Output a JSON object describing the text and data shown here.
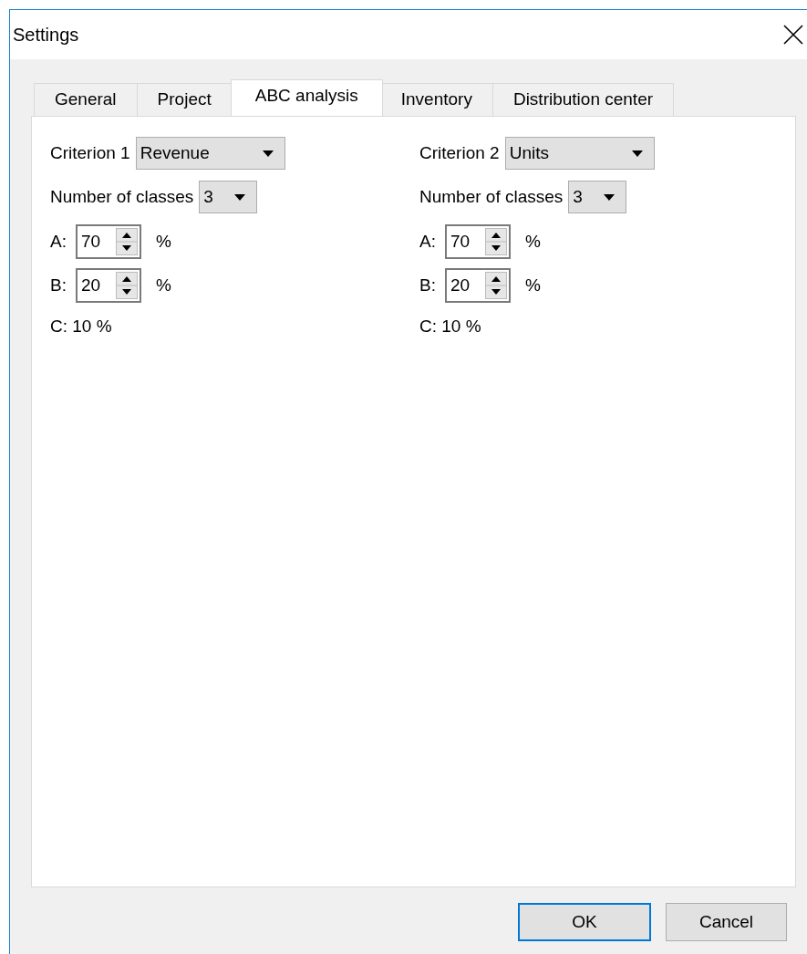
{
  "window": {
    "title": "Settings"
  },
  "tabs": [
    {
      "label": "General",
      "selected": false
    },
    {
      "label": "Project",
      "selected": false
    },
    {
      "label": "ABC analysis",
      "selected": true
    },
    {
      "label": "Inventory",
      "selected": false
    },
    {
      "label": "Distribution center",
      "selected": false
    }
  ],
  "criteria": [
    {
      "label": "Criterion 1",
      "value": "Revenue",
      "classes_label": "Number of classes",
      "classes_value": "3",
      "a_label": "A:",
      "a_value": "70",
      "a_unit": "%",
      "b_label": "B:",
      "b_value": "20",
      "b_unit": "%",
      "c_text": "C: 10 %"
    },
    {
      "label": "Criterion 2",
      "value": "Units",
      "classes_label": "Number of classes",
      "classes_value": "3",
      "a_label": "A:",
      "a_value": "70",
      "a_unit": "%",
      "b_label": "B:",
      "b_value": "20",
      "b_unit": "%",
      "c_text": "C: 10 %"
    }
  ],
  "buttons": [
    {
      "label": "OK",
      "focused": true
    },
    {
      "label": "Cancel",
      "focused": false
    }
  ]
}
